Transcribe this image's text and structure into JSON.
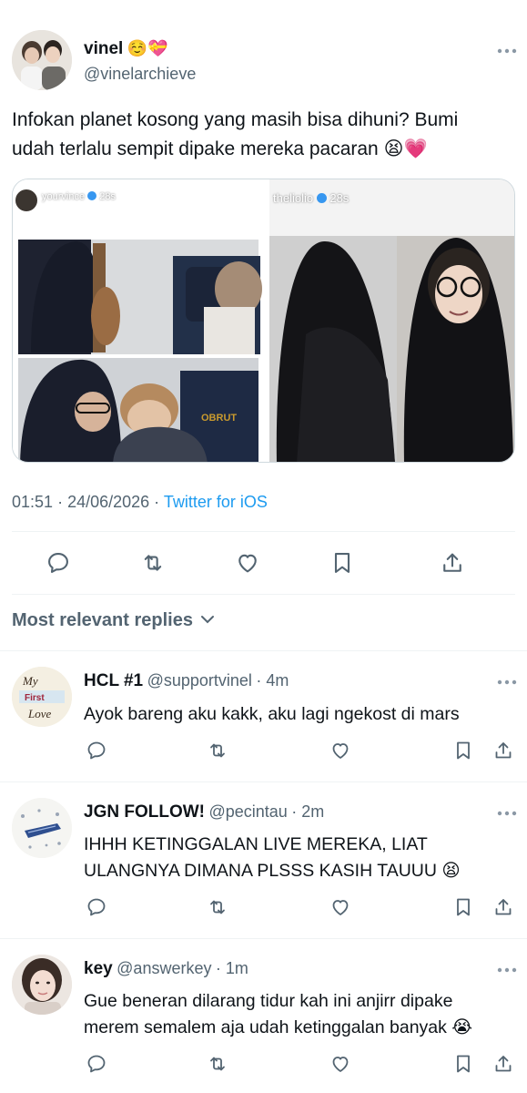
{
  "tweet": {
    "display_name": "vinel",
    "name_emoji": "☺️💝",
    "handle": "@vinelarchieve",
    "more_icon": "more-horizontal-icon",
    "text_line1": "Infokan planet kosong yang masih bisa dihuni? Bumi",
    "text_line2": "udah terlalu sempit dipake mereka pacaran 😫💗",
    "media": {
      "left_username": "yourvince",
      "left_time": "28s",
      "right_username": "theliolio",
      "right_time": "28s",
      "chair_text": "OBRUT"
    },
    "time": "01:51",
    "date": "24/06/2026",
    "source": "Twitter for iOS",
    "actions": [
      "reply-icon",
      "retweet-icon",
      "like-icon",
      "bookmark-icon",
      "share-icon"
    ]
  },
  "replies_header": {
    "label": "Most relevant replies"
  },
  "replies": [
    {
      "name": "HCL #1",
      "handle": "@supportvinel",
      "time": "4m",
      "avatar_text": [
        "My",
        "First",
        "Love"
      ],
      "text_line1": "Ayok bareng aku kakk, aku lagi ngekost di mars",
      "text_line2": ""
    },
    {
      "name": "JGN FOLLOW!",
      "handle": "@pecintau",
      "time": "2m",
      "text_line1": "IHHH KETINGGALAN LIVE MEREKA, LIAT",
      "text_line2": "ULANGNYA DIMANA PLSSS KASIH TAUUU 😫"
    },
    {
      "name": "key",
      "handle": "@answerkey",
      "time": "1m",
      "text_line1": "Gue beneran dilarang tidur kah ini anjirr dipake",
      "text_line2": "merem semalem aja udah ketinggalan banyak 😭"
    }
  ]
}
